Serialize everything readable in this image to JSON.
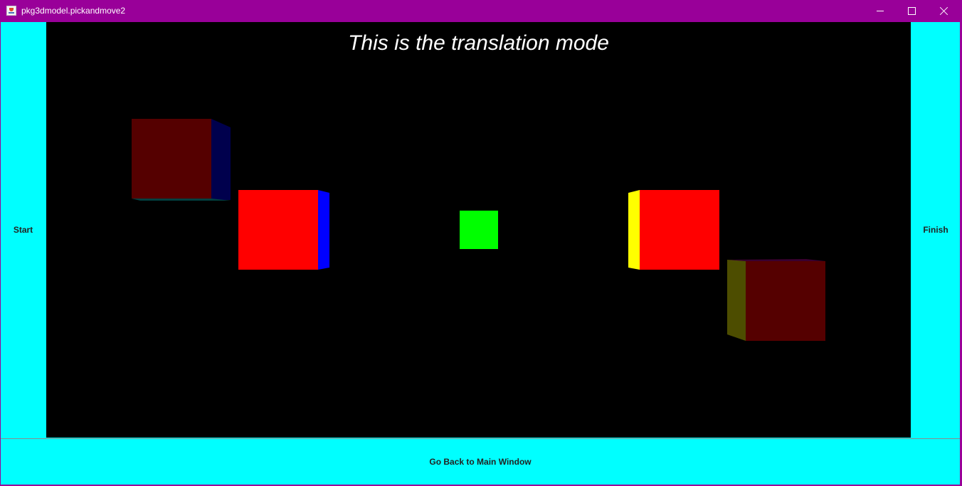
{
  "window": {
    "title": "pkg3dmodel.pickandmove2",
    "title_bar_color": "#990099",
    "controls": {
      "minimize": "minimize-icon",
      "maximize": "maximize-icon",
      "close": "close-icon"
    }
  },
  "buttons": {
    "start_label": "Start",
    "finish_label": "Finish",
    "back_label": "Go Back to Main Window",
    "color": "#00ffff"
  },
  "canvas": {
    "background": "#000000",
    "mode_text": "This is the translation mode",
    "objects": [
      {
        "name": "dark-red-cube-top-left",
        "front_color": "#550000",
        "side_color": "#00004d",
        "side": "right"
      },
      {
        "name": "red-cube-left",
        "front_color": "#ff0000",
        "side_color": "#0000ff",
        "side": "right"
      },
      {
        "name": "green-cube-center",
        "front_color": "#00ff00"
      },
      {
        "name": "red-cube-right",
        "front_color": "#ff0000",
        "side_color": "#ffff00",
        "side": "left"
      },
      {
        "name": "dark-red-cube-bottom-right",
        "front_color": "#550000",
        "side_color": "#4d4d00",
        "side": "left"
      }
    ]
  }
}
